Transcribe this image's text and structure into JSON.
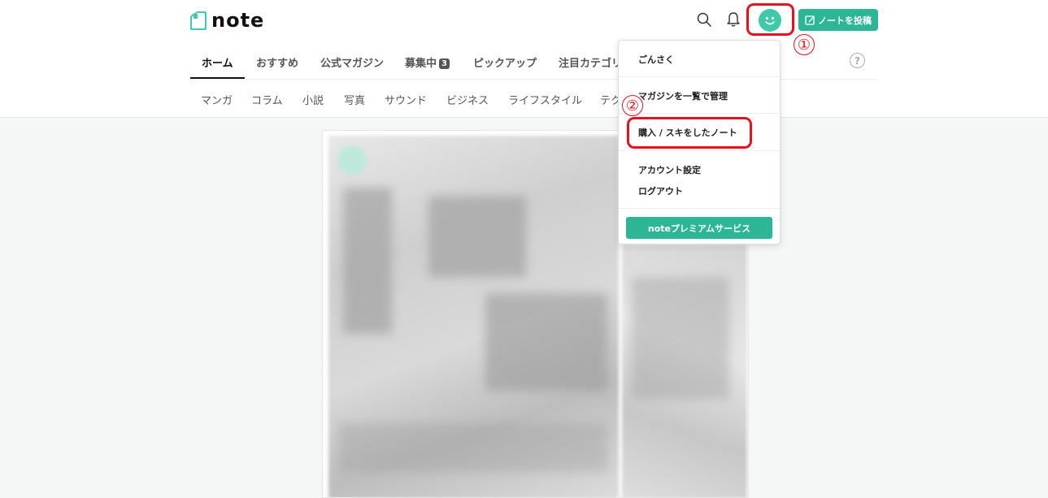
{
  "header": {
    "logo_text": "note",
    "post_button_label": "ノートを投稿",
    "search_icon": "search-icon",
    "bell_icon": "bell-icon",
    "brand_color": "#2cb696",
    "annotation_color": "#e8111b"
  },
  "callouts": {
    "one": "①",
    "two": "②"
  },
  "tabs": {
    "items": [
      {
        "label": "ホーム"
      },
      {
        "label": "おすすめ"
      },
      {
        "label": "公式マガジン"
      },
      {
        "label": "募集中"
      },
      {
        "label": "ピックアップ"
      },
      {
        "label": "注目カテゴリ"
      }
    ],
    "badge_count": "3",
    "help_label": "?"
  },
  "categories": {
    "items": [
      {
        "label": "マンガ"
      },
      {
        "label": "コラム"
      },
      {
        "label": "小説"
      },
      {
        "label": "写真"
      },
      {
        "label": "サウンド"
      },
      {
        "label": "ビジネス"
      },
      {
        "label": "ライフスタイル"
      },
      {
        "label": "テク"
      }
    ]
  },
  "menu": {
    "username": "ごんさく",
    "magazine_manage": "マガジンを一覧で管理",
    "purchased_liked": "購入 / スキをしたノート",
    "account_settings": "アカウント設定",
    "logout": "ログアウト",
    "premium_button": "noteプレミアムサービス"
  }
}
